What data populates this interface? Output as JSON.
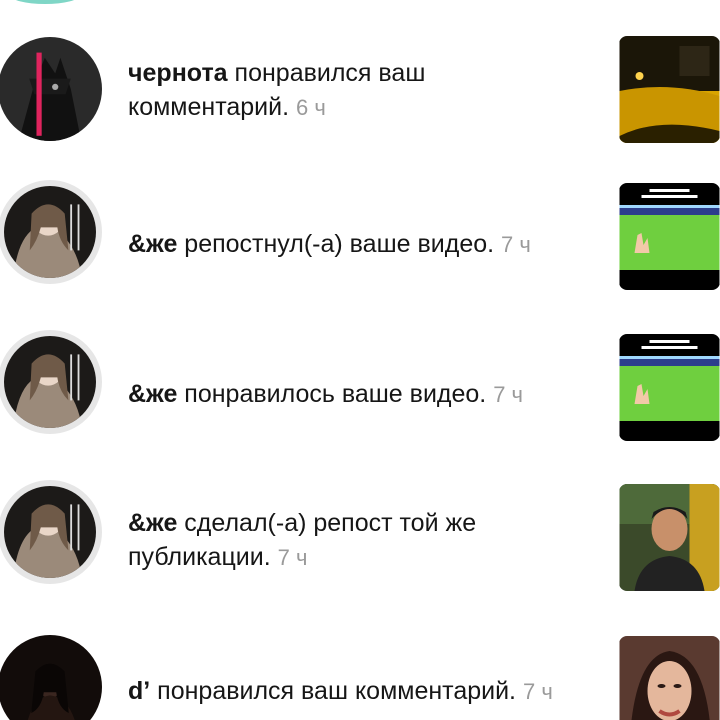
{
  "notifications": [
    {
      "user": "чернота",
      "action": " понравился ваш комментарий.",
      "time": "6 ч",
      "avatar_icon": "dark-figure-avatar",
      "thumb_icon": "night-street-thumbnail"
    },
    {
      "user": "&же",
      "action": " репостнул(-а) ваше видео.",
      "time": "7 ч",
      "avatar_icon": "girl-portrait-avatar",
      "thumb_icon": "football-field-thumbnail"
    },
    {
      "user": "&же",
      "action": " понравилось ваше видео.",
      "time": "7 ч",
      "avatar_icon": "girl-portrait-avatar",
      "thumb_icon": "football-field-thumbnail"
    },
    {
      "user": "&же",
      "action": " сделал(-а) репост той же публикации.",
      "time": "7 ч",
      "avatar_icon": "girl-portrait-avatar",
      "thumb_icon": "man-portrait-thumbnail"
    },
    {
      "user": "d’",
      "action": " понравился ваш комментарий.",
      "time": "7 ч",
      "avatar_icon": "dark-portrait-avatar",
      "thumb_icon": "woman-portrait-thumbnail"
    }
  ]
}
